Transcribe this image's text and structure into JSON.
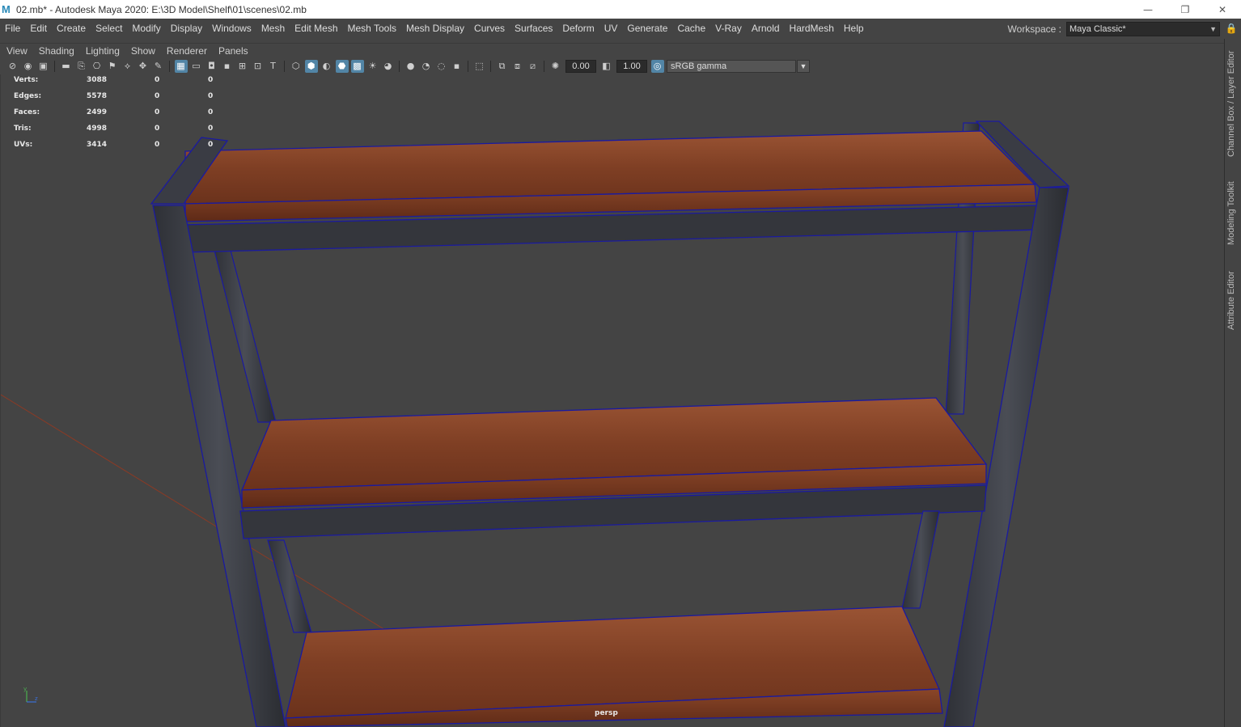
{
  "titlebar": {
    "title": "02.mb* - Autodesk Maya 2020: E:\\3D Model\\Shelf\\01\\scenes\\02.mb",
    "minimize": "—",
    "restore": "❐",
    "close": "✕"
  },
  "menu": [
    "File",
    "Edit",
    "Create",
    "Select",
    "Modify",
    "Display",
    "Windows",
    "Mesh",
    "Edit Mesh",
    "Mesh Tools",
    "Mesh Display",
    "Curves",
    "Surfaces",
    "Deform",
    "UV",
    "Generate",
    "Cache",
    "V-Ray",
    "Arnold",
    "HardMesh",
    "Help"
  ],
  "workspace": {
    "label": "Workspace :",
    "value": "Maya Classic*"
  },
  "side_tabs": [
    "Channel Box / Layer Editor",
    "Modeling Toolkit",
    "Attribute Editor"
  ],
  "panel_menu": [
    "View",
    "Shading",
    "Lighting",
    "Show",
    "Renderer",
    "Panels"
  ],
  "toolbar": {
    "exposure": "0.00",
    "gamma": "1.00",
    "colorspace": "sRGB gamma"
  },
  "hud": {
    "rows": [
      {
        "label": "Verts:",
        "v1": "3088",
        "v2": "0",
        "v3": "0"
      },
      {
        "label": "Edges:",
        "v1": "5578",
        "v2": "0",
        "v3": "0"
      },
      {
        "label": "Faces:",
        "v1": "2499",
        "v2": "0",
        "v3": "0"
      },
      {
        "label": "Tris:",
        "v1": "4998",
        "v2": "0",
        "v3": "0"
      },
      {
        "label": "UVs:",
        "v1": "3414",
        "v2": "0",
        "v3": "0"
      }
    ]
  },
  "viewport": {
    "camera": "persp",
    "axis_y": "y",
    "axis_z": "z",
    "wire_color": "#1a1aa0",
    "wood_color": "#8a4428",
    "metal_color": "#3a3d44"
  }
}
